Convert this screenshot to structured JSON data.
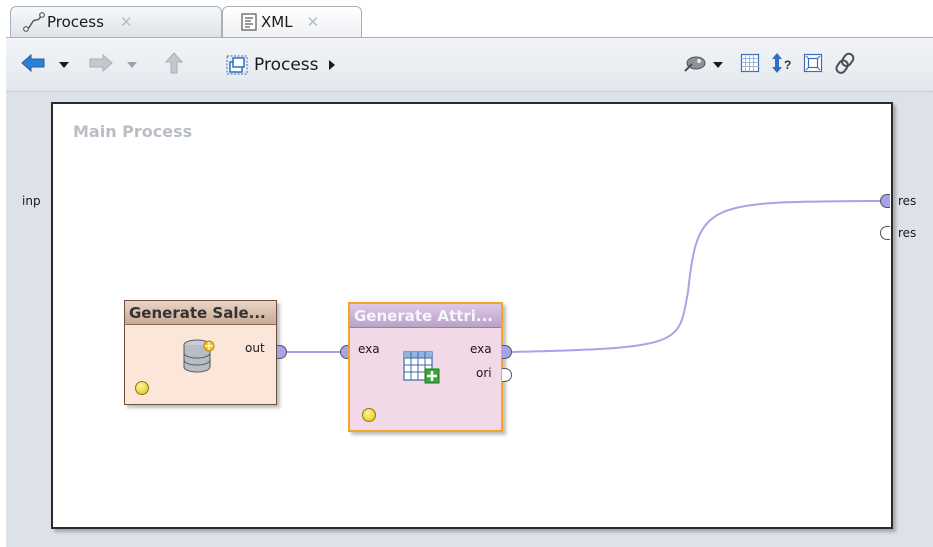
{
  "tabs": [
    {
      "label": "Process",
      "close": "✕",
      "icon": "process-icon"
    },
    {
      "label": "XML",
      "close": "✕",
      "icon": "xml-icon"
    }
  ],
  "toolbar": {
    "back_icon": "arrow-left-icon",
    "forward_icon": "arrow-right-icon",
    "up_icon": "arrow-up-icon",
    "breadcrumb": "Process",
    "right_icons": [
      "wand-icon",
      "grid-icon",
      "arrange-icon",
      "fit-icon",
      "link-icon"
    ]
  },
  "canvas": {
    "title": "Main Process",
    "input_ports": [
      "inp"
    ],
    "output_ports": [
      "res",
      "res"
    ]
  },
  "operators": [
    {
      "name": "Generate Sale...",
      "icon": "database-icon",
      "inputs": [],
      "outputs": [
        "out"
      ],
      "color": "#fbe6d9"
    },
    {
      "name": "Generate Attri...",
      "icon": "table-add-icon",
      "inputs": [
        "exa"
      ],
      "outputs": [
        "exa",
        "ori"
      ],
      "color": "#f2d9e8",
      "selected_border": "#f3a52a"
    }
  ],
  "colors": {
    "wire": "#a8a3e8",
    "port_connected": "#a8a3e8"
  }
}
